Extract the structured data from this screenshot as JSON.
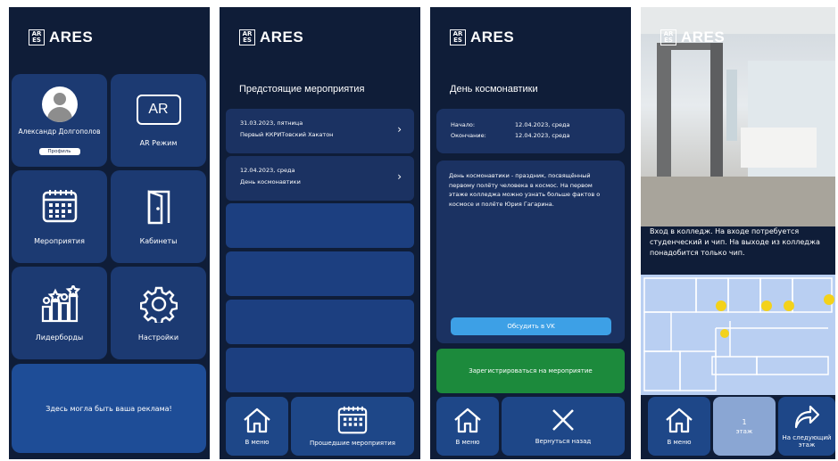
{
  "logo": {
    "text": "ARES",
    "mark": "AR ES"
  },
  "screen1": {
    "profile_name": "Александр Долгополов",
    "profile_button": "Профиль",
    "ar_label": "AR Режим",
    "ar_icon_text": "AR",
    "events_label": "Мероприятия",
    "cabinets_label": "Кабинеты",
    "leaderboards_label": "Лидерборды",
    "settings_label": "Настройки",
    "ad_text": "Здесь могла быть ваша реклама!"
  },
  "screen2": {
    "title": "Предстоящие мероприятия",
    "events": [
      {
        "date": "31.03.2023, пятница",
        "name": "Первый ККРИТовский Хакатон"
      },
      {
        "date": "12.04.2023, среда",
        "name": "День космонавтики"
      }
    ],
    "home_label": "В меню",
    "past_label": "Прошедшие мероприятия"
  },
  "screen3": {
    "title": "День космонавтики",
    "start_key": "Начало:",
    "start_val": "12.04.2023, среда",
    "end_key": "Окончание:",
    "end_val": "12.04.2023, среда",
    "description": "День космонавтики - праздник, посвящённый первому полёту человека в космос. На первом этаже колледжа можно узнать больше фактов о космосе и полёте Юрия Гагарина.",
    "vk_button": "Обсудить в VK",
    "register_button": "Зарегистрироваться на мероприятие",
    "home_label": "В меню",
    "back_label": "Вернуться назад"
  },
  "screen4": {
    "route_text": "Вход в колледж. На входе потребуется студенческий и чип. На выходе из колледжа понадобится только чип.",
    "home_label": "В меню",
    "floor_number": "1",
    "floor_label": "этаж",
    "next_label": "На следующий этаж"
  },
  "colors": {
    "background": "#0f1d38",
    "tile": "#1c3a72",
    "card": "#1b3262",
    "vk_button": "#3da0e6",
    "register_button": "#1c8a3c",
    "map_marker": "#f3d21b"
  }
}
